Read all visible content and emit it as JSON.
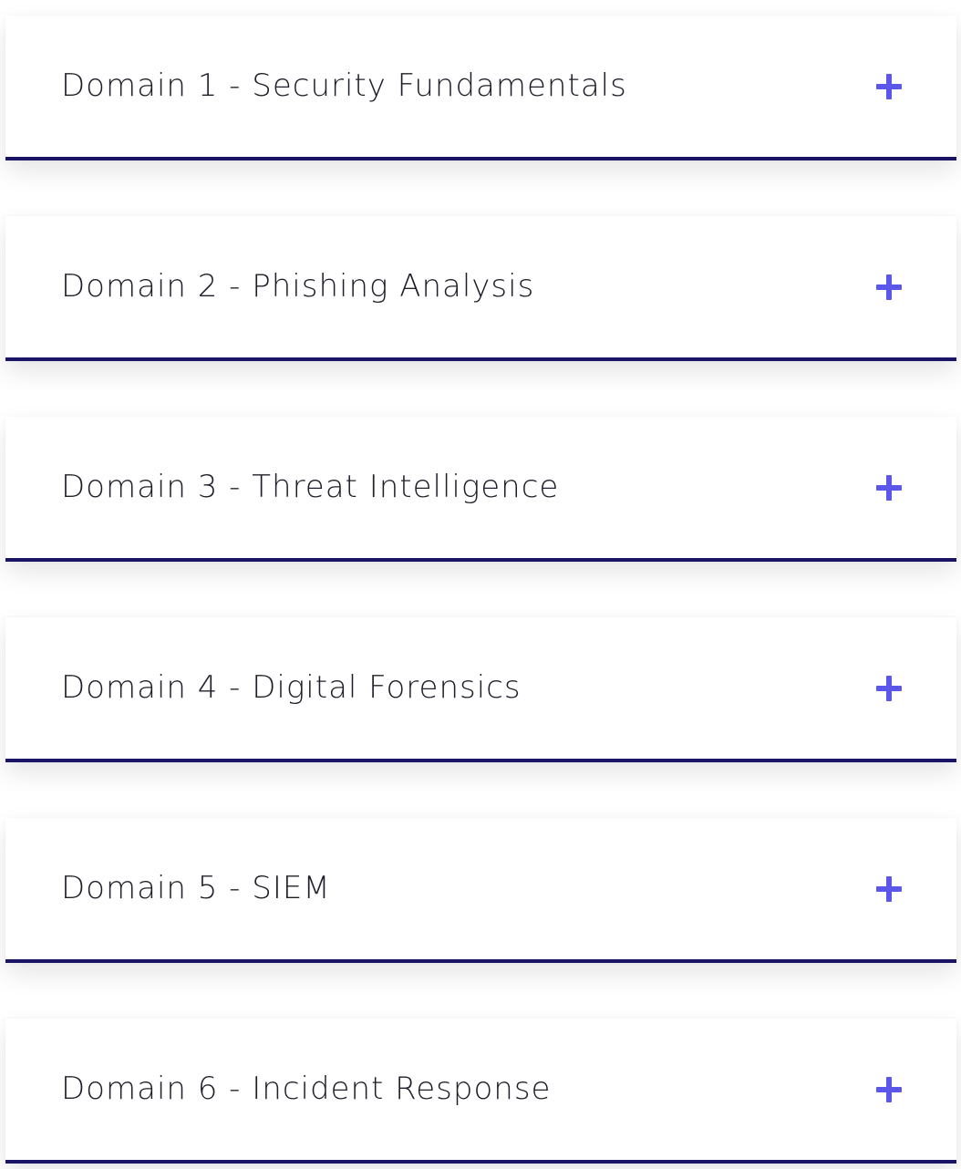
{
  "accordion": {
    "items": [
      {
        "label": "Domain 1 - Security Fundamentals"
      },
      {
        "label": "Domain 2 - Phishing Analysis"
      },
      {
        "label": "Domain 3 - Threat Intelligence"
      },
      {
        "label": "Domain 4 - Digital Forensics"
      },
      {
        "label": "Domain 5 - SIEM"
      },
      {
        "label": "Domain 6 - Incident Response"
      }
    ],
    "expand_icon": "plus-icon",
    "colors": {
      "accent": "#5b57ea",
      "border": "#1b1464",
      "text": "#1e1e2a"
    }
  }
}
